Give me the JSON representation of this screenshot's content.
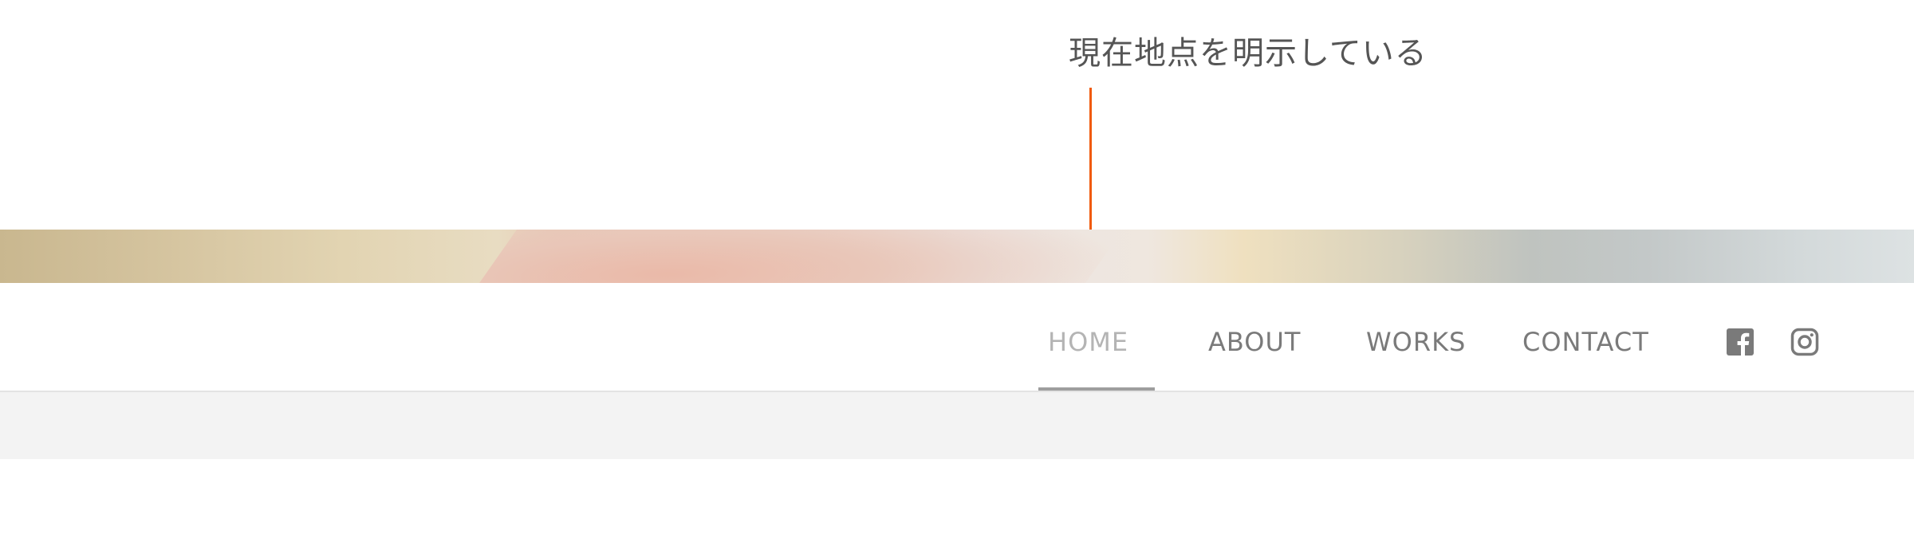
{
  "annotation": {
    "text": "現在地点を明示している",
    "color": "#f05a0a"
  },
  "nav": {
    "items": [
      {
        "label": "HOME",
        "active": true
      },
      {
        "label": "ABOUT",
        "active": false
      },
      {
        "label": "WORKS",
        "active": false
      },
      {
        "label": "CONTACT",
        "active": false
      }
    ],
    "active_color": "#b4b4b4",
    "text_color": "#7a7a7a"
  },
  "social": {
    "icons": [
      "facebook-icon",
      "instagram-icon"
    ]
  }
}
